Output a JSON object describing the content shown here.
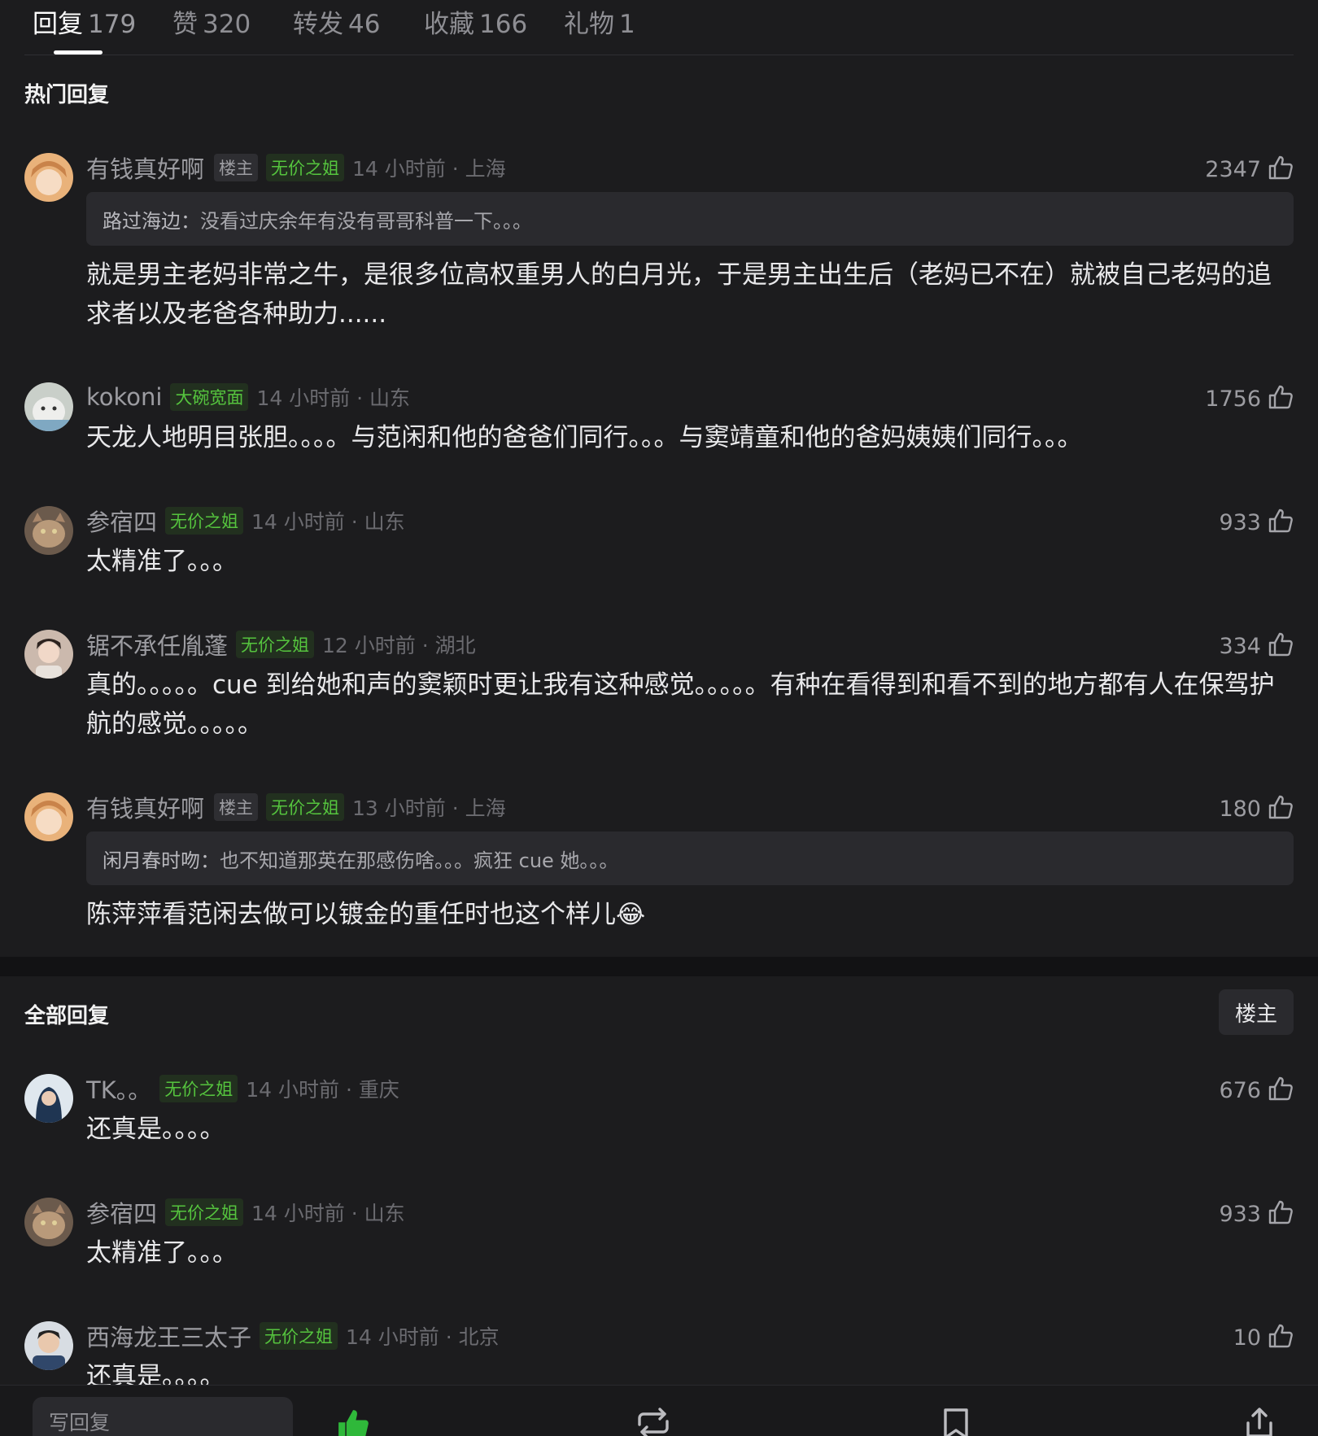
{
  "tabs": [
    {
      "label": "回复",
      "count": "179"
    },
    {
      "label": "赞",
      "count": "320"
    },
    {
      "label": "转发",
      "count": "46"
    },
    {
      "label": "收藏",
      "count": "166"
    },
    {
      "label": "礼物",
      "count": "1"
    }
  ],
  "hot": {
    "title": "热门回复",
    "comments": [
      {
        "username": "有钱真好啊",
        "owner_badge": "楼主",
        "badge": "无价之姐",
        "time": "14 小时前 · 上海",
        "likes": "2347",
        "quote_name": "路过海边：",
        "quote_text": "没看过庆余年有没有哥哥科普一下。。。",
        "text": "就是男主老妈非常之牛，是很多位高权重男人的白月光，于是男主出生后（老妈已不在）就被自己老妈的追求者以及老爸各种助力......"
      },
      {
        "username": "kokoni",
        "badge": "大碗宽面",
        "time": "14 小时前 · 山东",
        "likes": "1756",
        "text": "天龙人地明目张胆。。。。与范闲和他的爸爸们同行。。。与窦靖童和他的爸妈姨姨们同行。。。"
      },
      {
        "username": "参宿四",
        "badge": "无价之姐",
        "time": "14 小时前 · 山东",
        "likes": "933",
        "text": "太精准了。。。"
      },
      {
        "username": "锯不承任胤蓬",
        "badge": "无价之姐",
        "time": "12 小时前 · 湖北",
        "likes": "334",
        "text": "真的。。。。。cue 到给她和声的窦颖时更让我有这种感觉。。。。。有种在看得到和看不到的地方都有人在保驾护航的感觉。。。。。"
      },
      {
        "username": "有钱真好啊",
        "owner_badge": "楼主",
        "badge": "无价之姐",
        "time": "13 小时前 · 上海",
        "likes": "180",
        "quote_name": "闲月春时吻：",
        "quote_text": "也不知道那英在那感伤啥。。。疯狂 cue 她。。。",
        "text": "陈萍萍看范闲去做可以镀金的重任时也这个样儿😂"
      }
    ]
  },
  "all": {
    "title": "全部回复",
    "filter_label": "楼主",
    "comments": [
      {
        "username": "TK。。",
        "badge": "无价之姐",
        "time": "14 小时前 · 重庆",
        "likes": "676",
        "text": "还真是。。。。"
      },
      {
        "username": "参宿四",
        "badge": "无价之姐",
        "time": "14 小时前 · 山东",
        "likes": "933",
        "text": "太精准了。。。"
      },
      {
        "username": "西海龙王三太子",
        "badge": "无价之姐",
        "time": "14 小时前 · 北京",
        "likes": "10",
        "text": "还真是。。。。"
      }
    ]
  },
  "bottom": {
    "reply_placeholder": "写回复",
    "icons": [
      "thumbs-up-icon",
      "repost-icon",
      "bookmark-icon",
      "share-icon"
    ]
  },
  "colors": {
    "background": "#1c1c1e",
    "badge_green": "#55c43e",
    "like_green": "#2fb83a"
  }
}
